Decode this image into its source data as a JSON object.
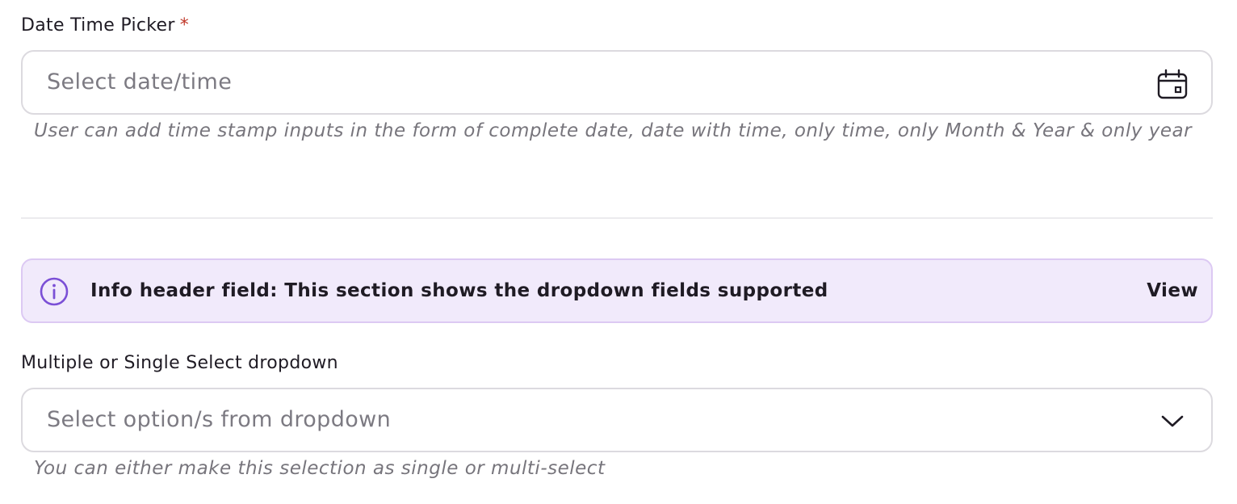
{
  "datetime_field": {
    "label": "Date Time Picker",
    "required_mark": "*",
    "placeholder": "Select date/time",
    "icon": "calendar-icon",
    "helper": "User can add time stamp inputs in the form of complete date, date with time, only time, only Month & Year & only year"
  },
  "info_banner": {
    "icon": "info-circle-icon",
    "text": "Info header field: This section shows the dropdown fields supported",
    "action_label": "View",
    "colors": {
      "background": "#f1eafb",
      "border": "#dcc9f3",
      "icon": "#7b4fd6"
    }
  },
  "dropdown_field": {
    "label": "Multiple or Single Select dropdown",
    "placeholder": "Select option/s from dropdown",
    "icon": "chevron-down-icon",
    "helper": "You can either make this selection as single or multi-select"
  },
  "colors": {
    "required": "#c0392b",
    "text": "#1f1b24",
    "placeholder": "#7c7a82",
    "helper": "#77757c",
    "input_border": "#dcdadf"
  }
}
